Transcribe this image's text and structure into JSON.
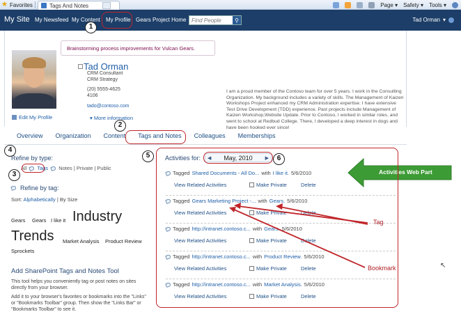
{
  "ie": {
    "favorites": "Favorites",
    "tab_title": "Tags And Notes",
    "menu": [
      "Page",
      "Safety",
      "Tools"
    ]
  },
  "nav": {
    "site_title": "My Site",
    "links": [
      "My Newsfeed",
      "My Content",
      "My Profile",
      "Gears Project Home"
    ],
    "search_placeholder": "Find People",
    "user": "Tad Orman"
  },
  "profile": {
    "status": "Brainstorming process improvements for Vulcan Gears.",
    "name": "Tad Orman",
    "title1": "CRM Consultant",
    "title2": "CRM Strategy",
    "phone": "(20) 5555-4625",
    "ext": "4106",
    "email": "tado@contoso.com",
    "more_info": "More information",
    "edit": "Edit My Profile",
    "about": "I am a proud member of the Contoso team for over 5 years. I work in the Consulting Organization. My background includes a variety of skills. The Management of Kaizen Workshops Project enhanced my CRM Administration expertise. I have extensive Test Drive Development (TDD) experience. Past projects include Management of Kaizen Workshop,Website Update. Prior to Contoso, I worked in similar roles, and went to school at Redbud College. There, I developed a deep interest in dogs and have been hooked ever since!"
  },
  "tabs": [
    "Overview",
    "Organization",
    "Content",
    "Tags and Notes",
    "Colleagues",
    "Memberships"
  ],
  "left": {
    "refine_type": "Refine by type:",
    "type_all": "All",
    "type_tags": "Tags",
    "type_rest": "Notes | Private | Public",
    "refine_tag": "Refine by tag:",
    "sort_label": "Sort:",
    "sort_alpha": "Alphabetically",
    "sort_size": "| By Size",
    "cloud": {
      "gears": "Gears",
      "gears_like": "Gears",
      "i_like_it": "I like it",
      "industry": "Industry",
      "trends": "Trends",
      "market": "Market Analysis",
      "product": "Product Review",
      "sprockets": "Sprockets"
    },
    "tool_title": "Add SharePoint Tags and Notes Tool",
    "tool_text1": "This tool helps you conveniently tag or post notes on sites directly from your browser.",
    "tool_text2": "Add it to your browser's favorites or bookmarks into the \"Links\" or \"Bookmarks Toolbar\" group. Then show the \"Links Bar\" or \"Bookmarks Toolbar\" to see it."
  },
  "activities": {
    "label": "Activities for:",
    "month": "May, 2010",
    "view_related": "View Related Activities",
    "make_private": "Make Private",
    "delete": "Delete",
    "items": [
      {
        "prefix": "Tagged",
        "link": "Shared Documents - All Do...",
        "mid": "with",
        "tag": "I like it.",
        "date": "5/6/2010"
      },
      {
        "prefix": "Tagged",
        "link": "Gears Marketing Project -...",
        "mid": "with",
        "tag": "Gears.",
        "date": "5/6/2010"
      },
      {
        "prefix": "Tagged",
        "link": "http://intranet.contoso.c...",
        "mid": "with",
        "tag": "Gears.",
        "date": "5/6/2010"
      },
      {
        "prefix": "Tagged",
        "link": "http://intranet.contoso.c...",
        "mid": "with",
        "tag": "Product Review.",
        "date": "5/6/2010"
      },
      {
        "prefix": "Tagged",
        "link": "http://intranet.contoso.c...",
        "mid": "with",
        "tag": "Market Analysis.",
        "date": "5/6/2010"
      }
    ]
  },
  "annotations": {
    "callouts": {
      "webpart": "Activities Web Part",
      "tag": "Tag",
      "bookmark": "Bookmark"
    },
    "numbers": [
      "1",
      "2",
      "3",
      "4",
      "5",
      "6"
    ]
  },
  "colors": {
    "nav_bg": "#1c3e68",
    "link": "#1f5fa8",
    "annotation_red": "#c0252a",
    "arrow_green": "#3d9b35"
  }
}
